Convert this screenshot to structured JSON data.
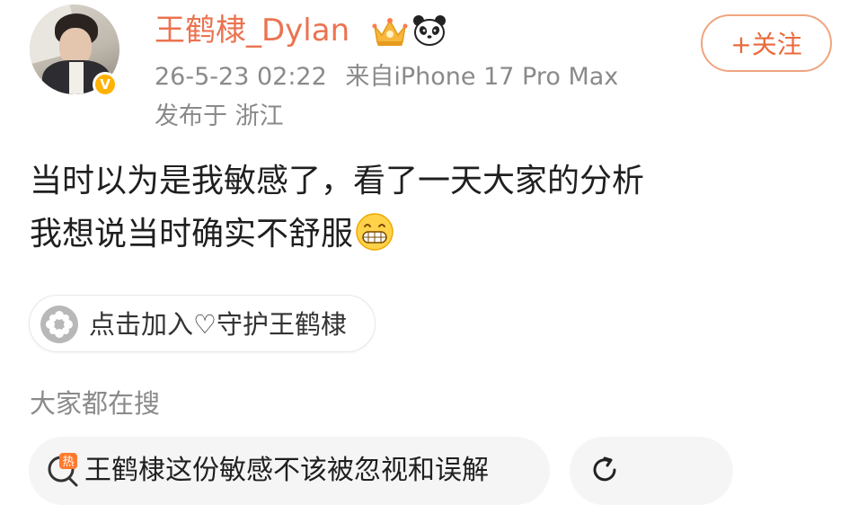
{
  "post": {
    "author": "王鹤棣_Dylan",
    "timestamp": "26-5-23 02:22",
    "source": "来自iPhone 17 Pro Max",
    "location": "发布于 浙江",
    "verified_badge": "V",
    "text_line1": "当时以为是我敏感了，看了一天大家的分析",
    "text_line2": "我想说当时确实不舒服",
    "emoji": "grinning-face-emoji"
  },
  "follow_button": {
    "label": "+关注"
  },
  "supertopic": {
    "label": "点击加入♡守护王鹤棣",
    "icon": "flower-icon"
  },
  "search": {
    "heading": "大家都在搜",
    "items": [
      {
        "label": "王鹤棣这份敏感不该被忽视和误解",
        "icon": "hot-search-icon"
      }
    ],
    "refresh_icon": "refresh-icon"
  },
  "colors": {
    "accent": "#eb7350",
    "muted": "#8a8a8a",
    "chip_bg": "#f5f5f5"
  }
}
